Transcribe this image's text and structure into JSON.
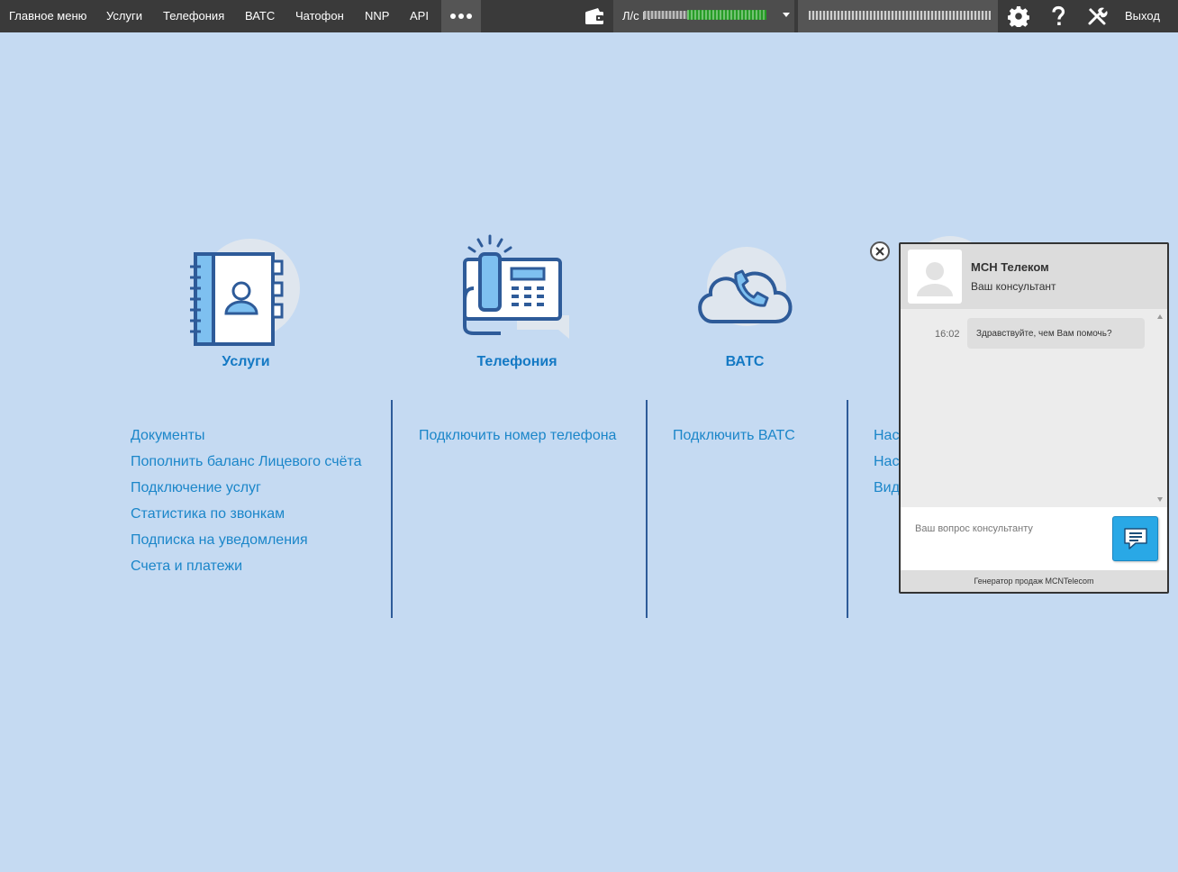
{
  "topbar": {
    "menu": [
      {
        "label": "Главное меню"
      },
      {
        "label": "Услуги"
      },
      {
        "label": "Телефония"
      },
      {
        "label": "ВАТС"
      },
      {
        "label": "Чатофон"
      },
      {
        "label": "NNP"
      },
      {
        "label": "API"
      }
    ],
    "more_icon": "more-dots-icon",
    "wallet_icon": "wallet-icon",
    "account_prefix": "Л/с N",
    "settings_icon": "gear-icon",
    "help_icon": "question-icon",
    "tools_icon": "tools-icon",
    "logout_label": "Выход",
    "bg_color": "#3a3a3a"
  },
  "tiles": [
    {
      "title": "Услуги",
      "icon": "address-book-icon"
    },
    {
      "title": "Телефония",
      "icon": "desk-phone-icon"
    },
    {
      "title": "ВАТС",
      "icon": "cloud-phone-icon"
    }
  ],
  "columns": [
    {
      "links": [
        "Документы",
        "Пополнить баланс Лицевого счёта",
        "Подключение услуг",
        "Статистика по звонкам",
        "Подписка на уведомления",
        "Счета и платежи"
      ]
    },
    {
      "links": [
        "Подключить номер телефона"
      ]
    },
    {
      "links": [
        "Подключить ВАТС"
      ]
    },
    {
      "links": [
        "Нас",
        "Нас",
        "Вид"
      ]
    }
  ],
  "chat": {
    "name": "МСН Телеком",
    "role": "Ваш консультант",
    "messages": [
      {
        "time": "16:02",
        "text": "Здравствуйте, чем Вам помочь?"
      }
    ],
    "input_placeholder": "Ваш вопрос консультанту",
    "footer": "Генератор продаж MCNTelecom",
    "send_icon": "chat-bubble-icon",
    "close_icon": "close-icon",
    "accent_color": "#29a8e6"
  },
  "colors": {
    "background": "#c5daf2",
    "link": "#1b86c9",
    "tile_title": "#1479c4",
    "icon_stroke": "#2e5b99",
    "icon_fill": "#7ec0f0"
  }
}
